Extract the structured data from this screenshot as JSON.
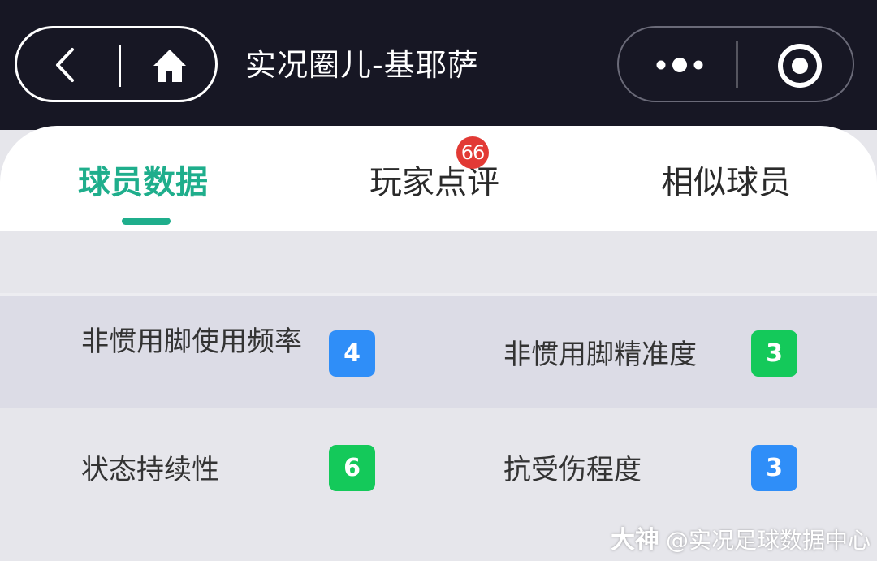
{
  "header": {
    "title": "实况圈儿-基耶萨"
  },
  "tabs": [
    {
      "label": "球员数据",
      "active": true
    },
    {
      "label": "玩家点评",
      "badge": "66"
    },
    {
      "label": "相似球员"
    }
  ],
  "attributes": {
    "rows": [
      [
        {
          "label": "非惯用脚使用频率",
          "value": "4",
          "color": "#2f8ef8"
        },
        {
          "label": "非惯用脚精准度",
          "value": "3",
          "color": "#14c95a"
        }
      ],
      [
        {
          "label": "状态持续性",
          "value": "6",
          "color": "#14c95a"
        },
        {
          "label": "抗受伤程度",
          "value": "3",
          "color": "#2f8ef8"
        }
      ]
    ]
  },
  "watermark": {
    "logo": "大神",
    "text": "@实况足球数据中心"
  },
  "colors": {
    "topbar": "#171724",
    "accent": "#1fae8c",
    "badge_red": "#e23a35",
    "blue": "#2f8ef8",
    "green": "#14c95a"
  }
}
